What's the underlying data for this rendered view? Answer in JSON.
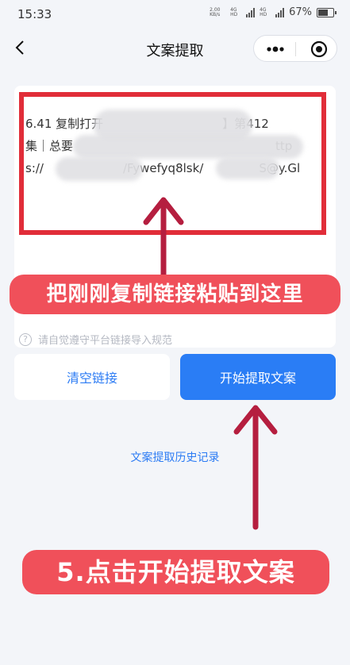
{
  "status": {
    "time": "15:33",
    "net1": "2.00 KB/s",
    "net2": "4G HD",
    "net3": "4G HD",
    "battery": "67%"
  },
  "nav": {
    "title": "文案提取",
    "more_icon": "more-dots-icon",
    "close_icon": "target-close-icon"
  },
  "link_box": {
    "lines": [
      "6.41 复制打开",
      "】第412",
      "集｜总要",
      "ttp",
      "s://",
      "/Fywefyq8lsk/",
      "S@y.Gl"
    ]
  },
  "annotations": {
    "paste_hint": "把刚刚复制链接粘贴到这里",
    "step_hint": "5.点击开始提取文案"
  },
  "notice": {
    "text": "请自觉遵守平台链接导入规范"
  },
  "buttons": {
    "clear": "清空链接",
    "extract": "开始提取文案"
  },
  "history": {
    "link": "文案提取历史记录"
  },
  "colors": {
    "accent": "#2a7df5",
    "annotation": "#f0505a",
    "frame": "#e12d39"
  }
}
